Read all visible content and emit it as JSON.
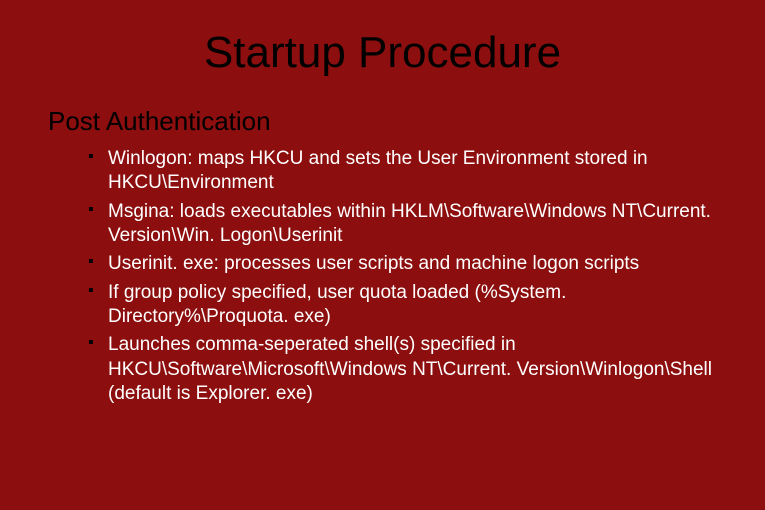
{
  "slide": {
    "title": "Startup Procedure",
    "subhead": "Post Authentication",
    "bullets": [
      "Winlogon: maps HKCU and sets the User Environment stored in HKCU\\Environment",
      "Msgina: loads executables within HKLM\\Software\\Windows NT\\Current. Version\\Win. Logon\\Userinit",
      "Userinit. exe: processes user scripts and machine logon scripts",
      "If group policy specified, user quota loaded (%System. Directory%\\Proquota. exe)",
      "Launches comma-seperated shell(s) specified in HKCU\\Software\\Microsoft\\Windows NT\\Current. Version\\Winlogon\\Shell (default is Explorer. exe)"
    ]
  }
}
